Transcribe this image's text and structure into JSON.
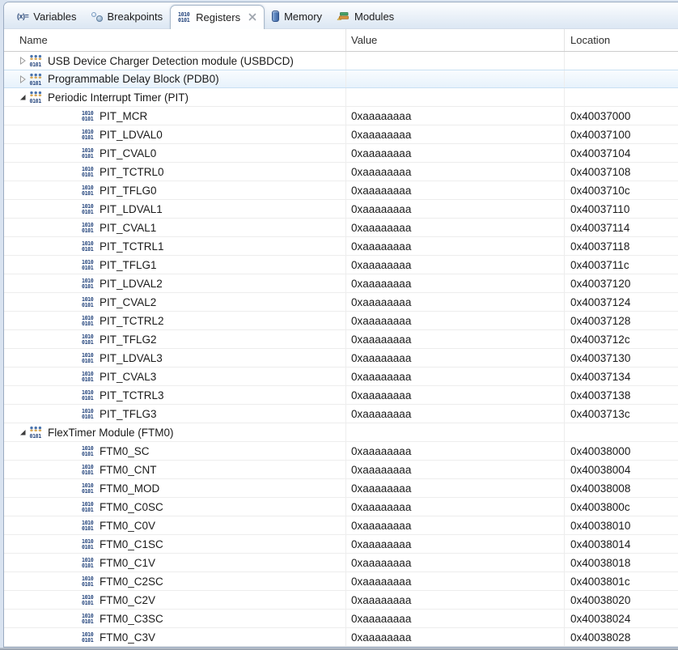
{
  "view": {
    "tabs": [
      {
        "label": "Variables",
        "active": false
      },
      {
        "label": "Breakpoints",
        "active": false
      },
      {
        "label": "Registers",
        "active": true,
        "closable": true
      },
      {
        "label": "Memory",
        "active": false
      },
      {
        "label": "Modules",
        "active": false
      }
    ]
  },
  "table": {
    "columns": [
      "Name",
      "Value",
      "Location"
    ],
    "rows": [
      {
        "type": "group",
        "expanded": false,
        "highlighted": false,
        "name": "USB Device Charger Detection module (USBDCD)",
        "value": "",
        "location": ""
      },
      {
        "type": "group",
        "expanded": false,
        "highlighted": true,
        "name": "Programmable Delay Block (PDB0)",
        "value": "",
        "location": ""
      },
      {
        "type": "group",
        "expanded": true,
        "highlighted": false,
        "name": "Periodic Interrupt Timer (PIT)",
        "value": "",
        "location": ""
      },
      {
        "type": "register",
        "name": "PIT_MCR",
        "value": "0xaaaaaaaa",
        "location": "0x40037000"
      },
      {
        "type": "register",
        "name": "PIT_LDVAL0",
        "value": "0xaaaaaaaa",
        "location": "0x40037100"
      },
      {
        "type": "register",
        "name": "PIT_CVAL0",
        "value": "0xaaaaaaaa",
        "location": "0x40037104"
      },
      {
        "type": "register",
        "name": "PIT_TCTRL0",
        "value": "0xaaaaaaaa",
        "location": "0x40037108"
      },
      {
        "type": "register",
        "name": "PIT_TFLG0",
        "value": "0xaaaaaaaa",
        "location": "0x4003710c"
      },
      {
        "type": "register",
        "name": "PIT_LDVAL1",
        "value": "0xaaaaaaaa",
        "location": "0x40037110"
      },
      {
        "type": "register",
        "name": "PIT_CVAL1",
        "value": "0xaaaaaaaa",
        "location": "0x40037114"
      },
      {
        "type": "register",
        "name": "PIT_TCTRL1",
        "value": "0xaaaaaaaa",
        "location": "0x40037118"
      },
      {
        "type": "register",
        "name": "PIT_TFLG1",
        "value": "0xaaaaaaaa",
        "location": "0x4003711c"
      },
      {
        "type": "register",
        "name": "PIT_LDVAL2",
        "value": "0xaaaaaaaa",
        "location": "0x40037120"
      },
      {
        "type": "register",
        "name": "PIT_CVAL2",
        "value": "0xaaaaaaaa",
        "location": "0x40037124"
      },
      {
        "type": "register",
        "name": "PIT_TCTRL2",
        "value": "0xaaaaaaaa",
        "location": "0x40037128"
      },
      {
        "type": "register",
        "name": "PIT_TFLG2",
        "value": "0xaaaaaaaa",
        "location": "0x4003712c"
      },
      {
        "type": "register",
        "name": "PIT_LDVAL3",
        "value": "0xaaaaaaaa",
        "location": "0x40037130"
      },
      {
        "type": "register",
        "name": "PIT_CVAL3",
        "value": "0xaaaaaaaa",
        "location": "0x40037134"
      },
      {
        "type": "register",
        "name": "PIT_TCTRL3",
        "value": "0xaaaaaaaa",
        "location": "0x40037138"
      },
      {
        "type": "register",
        "name": "PIT_TFLG3",
        "value": "0xaaaaaaaa",
        "location": "0x4003713c"
      },
      {
        "type": "group",
        "expanded": true,
        "highlighted": false,
        "name": "FlexTimer Module (FTM0)",
        "value": "",
        "location": ""
      },
      {
        "type": "register",
        "name": "FTM0_SC",
        "value": "0xaaaaaaaa",
        "location": "0x40038000"
      },
      {
        "type": "register",
        "name": "FTM0_CNT",
        "value": "0xaaaaaaaa",
        "location": "0x40038004"
      },
      {
        "type": "register",
        "name": "FTM0_MOD",
        "value": "0xaaaaaaaa",
        "location": "0x40038008"
      },
      {
        "type": "register",
        "name": "FTM0_C0SC",
        "value": "0xaaaaaaaa",
        "location": "0x4003800c"
      },
      {
        "type": "register",
        "name": "FTM0_C0V",
        "value": "0xaaaaaaaa",
        "location": "0x40038010"
      },
      {
        "type": "register",
        "name": "FTM0_C1SC",
        "value": "0xaaaaaaaa",
        "location": "0x40038014"
      },
      {
        "type": "register",
        "name": "FTM0_C1V",
        "value": "0xaaaaaaaa",
        "location": "0x40038018"
      },
      {
        "type": "register",
        "name": "FTM0_C2SC",
        "value": "0xaaaaaaaa",
        "location": "0x4003801c"
      },
      {
        "type": "register",
        "name": "FTM0_C2V",
        "value": "0xaaaaaaaa",
        "location": "0x40038020"
      },
      {
        "type": "register",
        "name": "FTM0_C3SC",
        "value": "0xaaaaaaaa",
        "location": "0x40038024"
      },
      {
        "type": "register",
        "name": "FTM0_C3V",
        "value": "0xaaaaaaaa",
        "location": "0x40038028"
      }
    ]
  },
  "icons": {
    "variables_glyph": "(x)=",
    "register_bits_top": "1010",
    "register_bits_bottom": "0101"
  },
  "colors": {
    "icon_blue": "#27477e",
    "row_highlight": "#e7f2fc",
    "tab_strip": "#dce7f3",
    "panel_border": "#9aabc1"
  }
}
